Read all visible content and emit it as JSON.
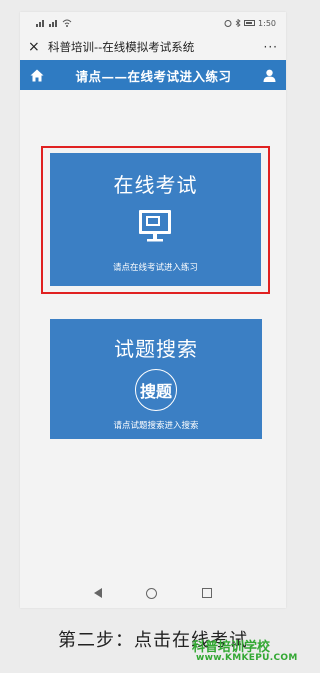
{
  "status_bar": {
    "signal_left": "⁴⁶",
    "time": "1:50"
  },
  "titlebar": {
    "close_glyph": "×",
    "title": "科普培训--在线模拟考试系统",
    "more_glyph": "···"
  },
  "navbar": {
    "title": "请点——在线考试进入练习",
    "home_icon": "home-icon",
    "user_icon": "user-icon",
    "color": "#2f7bc2"
  },
  "cards": {
    "exam": {
      "title": "在线考试",
      "subtitle": "请点在线考试进入练习",
      "icon": "monitor-icon"
    },
    "search": {
      "title": "试题搜索",
      "badge": "搜题",
      "subtitle": "请点试题搜索进入搜索"
    }
  },
  "caption": "第二步：点击在线考试",
  "watermark": {
    "name": "科普培训学校",
    "url": "www.KMKEPU.COM"
  },
  "colors": {
    "card": "#3b7fc4",
    "highlight": "#e02020",
    "watermark": "#33a833"
  }
}
